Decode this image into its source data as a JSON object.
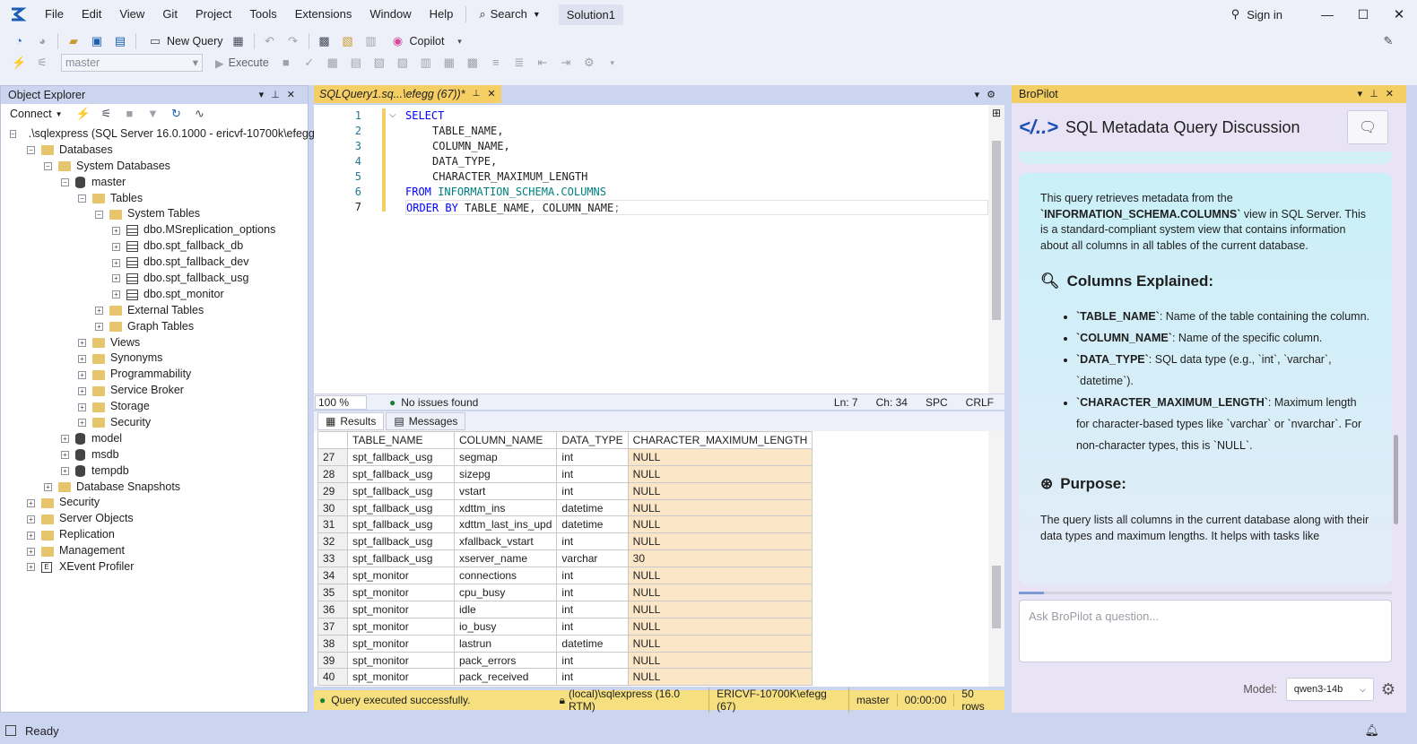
{
  "menu": {
    "items": [
      "File",
      "Edit",
      "View",
      "Git",
      "Project",
      "Tools",
      "Extensions",
      "Window",
      "Help"
    ],
    "search": "Search",
    "solution": "Solution1",
    "sign_in": "Sign in"
  },
  "toolbar": {
    "new_query": "New Query",
    "copilot": "Copilot",
    "database": "master",
    "execute": "Execute"
  },
  "object_explorer": {
    "title": "Object Explorer",
    "connect": "Connect",
    "server": ".\\sqlexpress (SQL Server 16.0.1000 - ericvf-10700k\\efegg)",
    "nodes": {
      "databases": "Databases",
      "system_databases": "System Databases",
      "master": "master",
      "tables": "Tables",
      "system_tables": "System Tables",
      "t1": "dbo.MSreplication_options",
      "t2": "dbo.spt_fallback_db",
      "t3": "dbo.spt_fallback_dev",
      "t4": "dbo.spt_fallback_usg",
      "t5": "dbo.spt_monitor",
      "external_tables": "External Tables",
      "graph_tables": "Graph Tables",
      "views": "Views",
      "synonyms": "Synonyms",
      "programmability": "Programmability",
      "service_broker": "Service Broker",
      "storage": "Storage",
      "security_db": "Security",
      "model": "model",
      "msdb": "msdb",
      "tempdb": "tempdb",
      "snapshots": "Database Snapshots",
      "security": "Security",
      "server_objects": "Server Objects",
      "replication": "Replication",
      "management": "Management",
      "xevent": "XEvent Profiler"
    }
  },
  "editor": {
    "tab": "SQLQuery1.sq...\\efegg (67))*",
    "code": {
      "l1": "SELECT",
      "l2": "TABLE_NAME,",
      "l3": "COLUMN_NAME,",
      "l4": "DATA_TYPE,",
      "l5": "CHARACTER_MAXIMUM_LENGTH",
      "l6_kw": "FROM",
      "l6_obj": "INFORMATION_SCHEMA.COLUMNS",
      "l7_kw1": "ORDER BY",
      "l7_rest": "TABLE_NAME, COLUMN_NAME",
      "l7_end": ";"
    },
    "zoom": "100 %",
    "issues": "No issues found",
    "ln": "Ln: 7",
    "ch": "Ch: 34",
    "spc": "SPC",
    "crlf": "CRLF"
  },
  "results": {
    "tab_results": "Results",
    "tab_messages": "Messages",
    "columns": [
      "TABLE_NAME",
      "COLUMN_NAME",
      "DATA_TYPE",
      "CHARACTER_MAXIMUM_LENGTH"
    ],
    "rows": [
      [
        "27",
        "spt_fallback_usg",
        "segmap",
        "int",
        "NULL"
      ],
      [
        "28",
        "spt_fallback_usg",
        "sizepg",
        "int",
        "NULL"
      ],
      [
        "29",
        "spt_fallback_usg",
        "vstart",
        "int",
        "NULL"
      ],
      [
        "30",
        "spt_fallback_usg",
        "xdttm_ins",
        "datetime",
        "NULL"
      ],
      [
        "31",
        "spt_fallback_usg",
        "xdttm_last_ins_upd",
        "datetime",
        "NULL"
      ],
      [
        "32",
        "spt_fallback_usg",
        "xfallback_vstart",
        "int",
        "NULL"
      ],
      [
        "33",
        "spt_fallback_usg",
        "xserver_name",
        "varchar",
        "30"
      ],
      [
        "34",
        "spt_monitor",
        "connections",
        "int",
        "NULL"
      ],
      [
        "35",
        "spt_monitor",
        "cpu_busy",
        "int",
        "NULL"
      ],
      [
        "36",
        "spt_monitor",
        "idle",
        "int",
        "NULL"
      ],
      [
        "37",
        "spt_monitor",
        "io_busy",
        "int",
        "NULL"
      ],
      [
        "38",
        "spt_monitor",
        "lastrun",
        "datetime",
        "NULL"
      ],
      [
        "39",
        "spt_monitor",
        "pack_errors",
        "int",
        "NULL"
      ],
      [
        "40",
        "spt_monitor",
        "pack_received",
        "int",
        "NULL"
      ]
    ],
    "status": "Query executed successfully.",
    "server": "(local)\\sqlexpress (16.0 RTM)",
    "user": "ERICVF-10700K\\efegg (67)",
    "db": "master",
    "time": "00:00:00",
    "rowcount": "50 rows"
  },
  "bropilot": {
    "pane_title": "BroPilot",
    "heading": "SQL Metadata Query Discussion",
    "intro_a": "This query retrieves metadata from the ",
    "intro_code": "`INFORMATION_SCHEMA.COLUMNS`",
    "intro_b": " view in SQL Server. This is a standard-compliant system view that contains information about all columns in all tables of the current database.",
    "section1": "Columns Explained:",
    "b1_code": "`TABLE_NAME`",
    "b1_text": ": Name of the table containing the column.",
    "b2_code": "`COLUMN_NAME`",
    "b2_text": ": Name of the specific column.",
    "b3_code": "`DATA_TYPE`",
    "b3_text": ": SQL data type (e.g., `int`, `varchar`, `datetime`).",
    "b4_code": "`CHARACTER_MAXIMUM_LENGTH`",
    "b4_text": ": Maximum length for character-based types like `varchar` or `nvarchar`. For non-character types, this is `NULL`.",
    "section2": "Purpose:",
    "purpose": "The query lists all columns in the current database along with their data types and maximum lengths. It helps with tasks like",
    "input_placeholder": "Ask BroPilot a question...",
    "model_label": "Model:",
    "model_value": "qwen3-14b"
  },
  "statusbar": {
    "text": "Ready"
  },
  "colors": {
    "accent": "#ccd5f0",
    "tab_active": "#f5cf64",
    "null_cell": "#fbe6c8",
    "status_ok": "#f5df7f"
  }
}
